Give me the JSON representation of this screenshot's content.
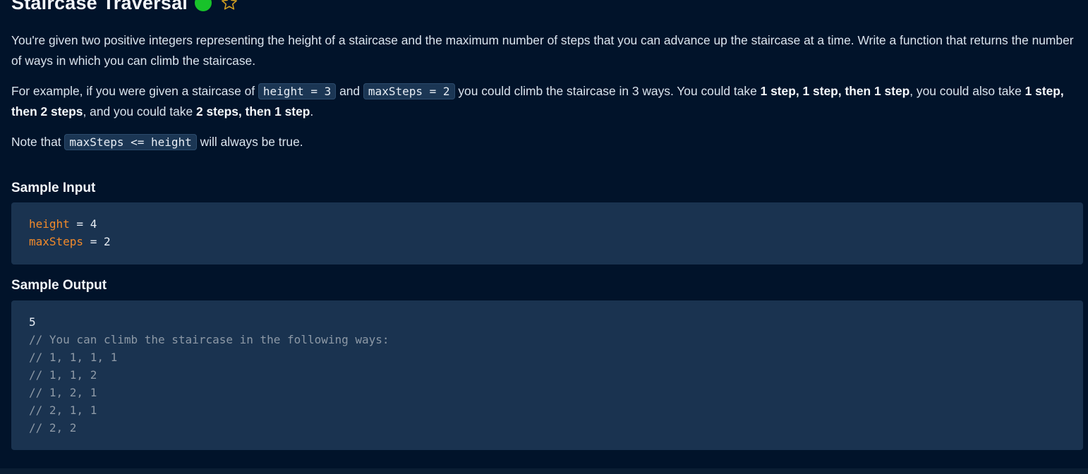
{
  "problem": {
    "title": "Staircase Traversal",
    "status": "completed",
    "colors": {
      "status_dot": "#18c22a",
      "star_outline": "#d9a321",
      "variable": "#f28a2a",
      "comment": "#8d99a6",
      "background": "#01132a",
      "code_block": "#1a3350"
    }
  },
  "description": {
    "p1": "You're given two positive integers representing the height of a staircase and the maximum number of steps that you can advance up the staircase at a time. Write a function that returns the number of ways in which you can climb the staircase.",
    "p2_a": "For example, if you were given a staircase of ",
    "p2_code1": "height = 3",
    "p2_b": " and ",
    "p2_code2": "maxSteps = 2",
    "p2_c": " you could climb the staircase in 3 ways. You could take ",
    "p2_bold1": "1 step, 1 step, then 1 step",
    "p2_d": ", you could also take ",
    "p2_bold2": "1 step, then 2 steps",
    "p2_e": ", and you could take ",
    "p2_bold3": "2 steps, then 1 step",
    "p2_f": ".",
    "p3_a": "Note that ",
    "p3_code": "maxSteps <= height",
    "p3_b": " will always be true."
  },
  "sample_input": {
    "heading": "Sample Input",
    "lines": [
      {
        "var": "height",
        "op": " = ",
        "value": "4"
      },
      {
        "var": "maxSteps",
        "op": " = ",
        "value": "2"
      }
    ]
  },
  "sample_output": {
    "heading": "Sample Output",
    "result": "5",
    "comments": [
      "// You can climb the staircase in the following ways:",
      "// 1, 1, 1, 1",
      "// 1, 1, 2",
      "// 1, 2, 1",
      "// 2, 1, 1",
      "// 2, 2"
    ]
  },
  "icons": {
    "status": "completed-dot-icon",
    "favorite": "star-outline-icon"
  }
}
